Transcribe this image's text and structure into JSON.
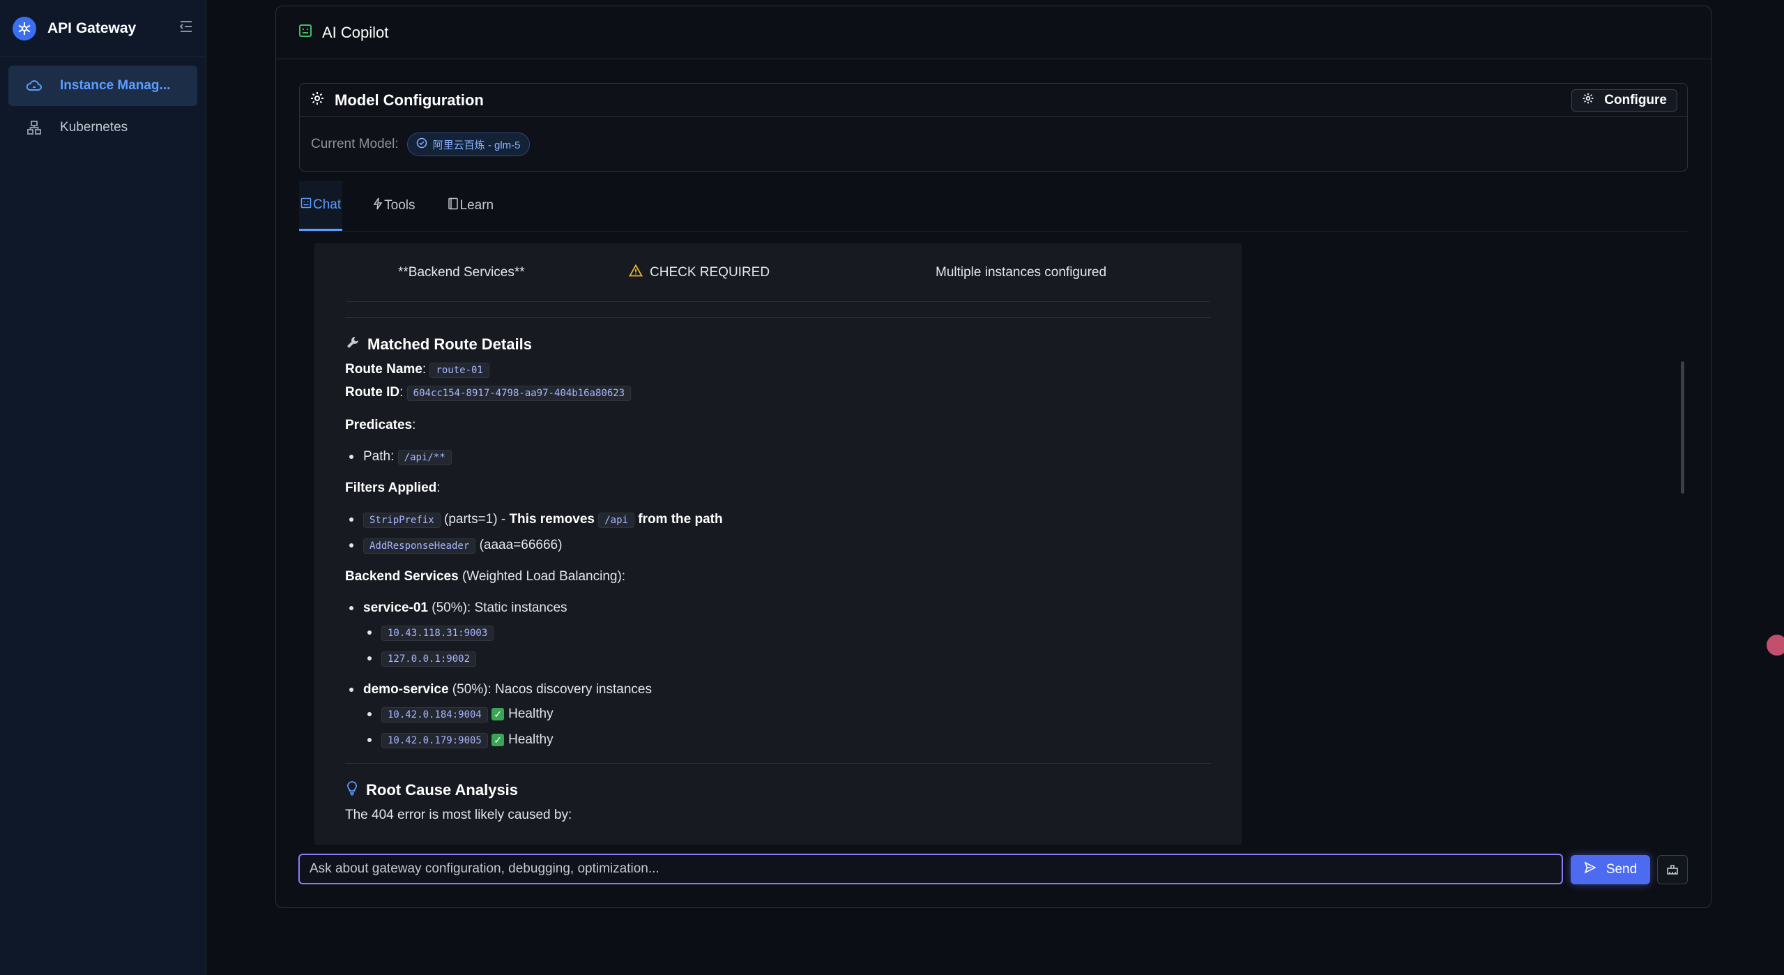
{
  "app": {
    "name": "API Gateway"
  },
  "sidebar": {
    "items": [
      {
        "label": "Instance Manag...",
        "icon": "cloud-icon",
        "active": true
      },
      {
        "label": "Kubernetes",
        "icon": "cluster-icon",
        "active": false
      }
    ]
  },
  "panel": {
    "title": "AI Copilot"
  },
  "model": {
    "title": "Model Configuration",
    "configure_label": "Configure",
    "current_label": "Current Model:",
    "current_value": "阿里云百炼 - glm-5"
  },
  "tabs": [
    {
      "label": "Chat",
      "active": true
    },
    {
      "label": "Tools",
      "active": false
    },
    {
      "label": "Learn",
      "active": false
    }
  ],
  "message": {
    "table_row": {
      "component": "**Backend Services**",
      "status": "CHECK REQUIRED",
      "note": "Multiple instances configured"
    },
    "matched_heading": "Matched Route Details",
    "route_name_label": "Route Name",
    "route_name": "route-01",
    "route_id_label": "Route ID",
    "route_id": "604cc154-8917-4798-aa97-404b16a80623",
    "predicates_label": "Predicates",
    "predicate_path_label": "Path:",
    "predicate_path": "/api/**",
    "filters_label": "Filters Applied",
    "filter1_code": "StripPrefix",
    "filter1_args": "(parts=1) - ",
    "filter1_note_a": "This removes",
    "filter1_code2": "/api",
    "filter1_note_b": "from the path",
    "filter2_code": "AddResponseHeader",
    "filter2_args": "(aaaa=66666)",
    "backend_label": "Backend Services",
    "backend_suffix": "(Weighted Load Balancing):",
    "service1_name": "service-01",
    "service1_desc": "(50%): Static instances",
    "service1_instances": [
      "10.43.118.31:9003",
      "127.0.0.1:9002"
    ],
    "service2_name": "demo-service",
    "service2_desc": "(50%): Nacos discovery instances",
    "service2_instances": [
      "10.42.0.184:9004",
      "10.42.0.179:9005"
    ],
    "healthy_label": "Healthy",
    "root_heading": "Root Cause Analysis",
    "root_text": "The 404 error is most likely caused by:"
  },
  "input": {
    "placeholder": "Ask about gateway configuration, debugging, optimization...",
    "send_label": "Send"
  },
  "colors": {
    "accent": "#5c9cff",
    "send": "#4c6bf0",
    "input_border": "#8b7cf6"
  }
}
